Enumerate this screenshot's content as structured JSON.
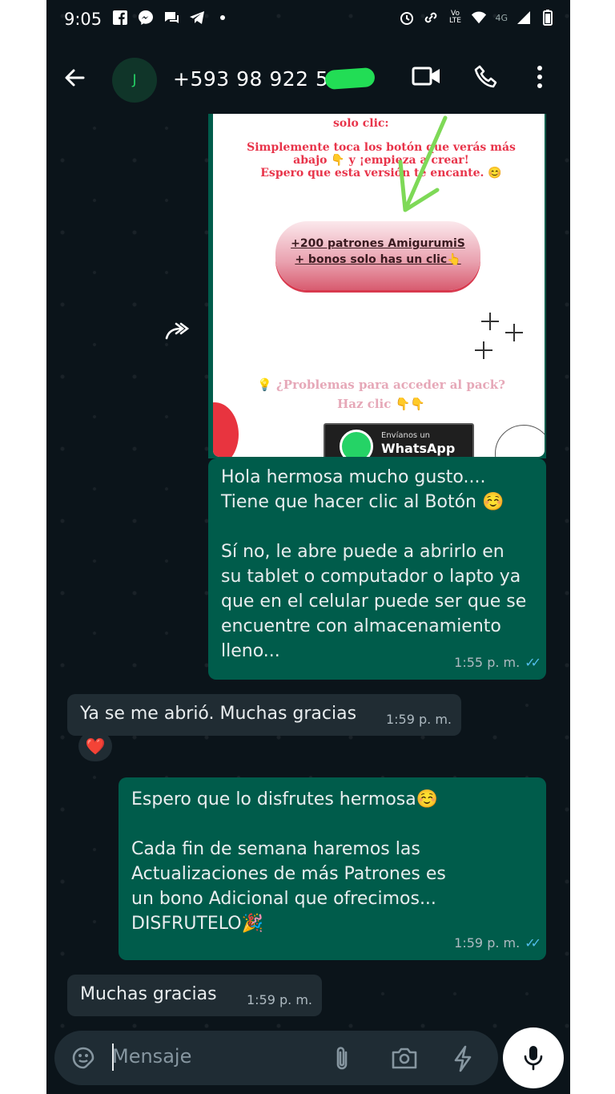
{
  "status_bar": {
    "time": "9:05",
    "network": "4G"
  },
  "header": {
    "avatar_letter": "J",
    "contact": "+593 98 922 53"
  },
  "image_message": {
    "line_solo": "solo clic:",
    "line1": "Simplemente toca los botón que verás más",
    "line2": "abajo 👇 y ¡empieza a crear!",
    "line3": "Espero que esta versión te encante. 😊",
    "pill_line1": "+200 patrones AmigurumiS",
    "pill_line2": "+ bonos solo has un clic👆",
    "problem_line1": "💡 ¿Problemas para acceder al pack?",
    "problem_line2": "Haz clic 👇👇",
    "wa_small": "Envíanos un",
    "wa_big": "WhatsApp"
  },
  "messages": [
    {
      "text": "Hola hermosa mucho gusto....\nTiene que hacer clic al Botón ☺️\n\nSí no, le abre puede a abrirlo en\nsu tablet o computador o lapto ya\nque en el celular puede ser que se\nencuentre con almacenamiento\nlleno...",
      "time": "1:55 p. m."
    },
    {
      "text": "Ya se me abrió. Muchas gracias",
      "time": "1:59 p. m.",
      "reaction": "❤️"
    },
    {
      "text": "Espero que lo disfrutes hermosa☺️\n\nCada fin de semana haremos las\nActualizaciones de más Patrones es\nun bono Adicional que ofrecimos...\nDISFRUTELO🎉",
      "time": "1:59 p. m."
    },
    {
      "text": "Muchas gracias",
      "time": "1:59 p. m."
    }
  ],
  "input": {
    "placeholder": "Mensaje"
  },
  "colors": {
    "bg": "#0b141a",
    "outgoing": "#005c4b",
    "incoming": "#202c33",
    "accent": "#25d366",
    "ticks": "#53bdeb"
  }
}
